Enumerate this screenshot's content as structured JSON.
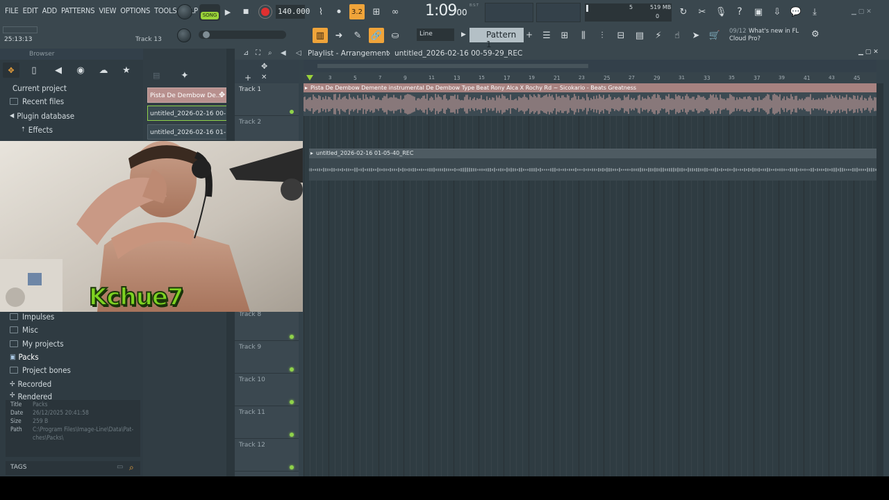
{
  "menu": [
    "FILE",
    "EDIT",
    "ADD",
    "PATTERNS",
    "VIEW",
    "OPTIONS",
    "TOOLS",
    "HELP"
  ],
  "transport": {
    "song_label": "SONG",
    "tempo": "140.000",
    "time": "1:09",
    "time_small": "00",
    "time_unit": "B:S:T",
    "cpu": "519 MB",
    "voices": "5",
    "voices2": "0",
    "pattern_name": "Pattern 1",
    "snap": "Line"
  },
  "hint": {
    "time": "25:13:13",
    "track": "Track 13"
  },
  "news": {
    "count": "09/12",
    "text1": "What's new in FL",
    "text2": "Cloud Pro?"
  },
  "browser": {
    "title": "Browser",
    "items_top": [
      "Current project",
      "Recent files",
      "Plugin database",
      "Effects"
    ],
    "items_bottom": [
      "Impulses",
      "Misc",
      "My projects",
      "Packs",
      "Project bones",
      "Recorded",
      "Rendered"
    ],
    "info": {
      "title_k": "Title",
      "title_v": "Packs",
      "date_k": "Date",
      "date_v": "26/12/2025 20:41:58",
      "size_k": "Size",
      "size_v": "259 B",
      "path_k": "Path",
      "path_v1": "C:\\Program Files\\Image-Line\\Data\\Pat-",
      "path_v2": "ches\\Packs\\"
    },
    "tags": "TAGS"
  },
  "patterns": [
    "Pista De Dembow De...",
    "untitled_2026-02-16 00-...",
    "untitled_2026-02-16 01-..."
  ],
  "playlist": {
    "title": "Playlist - Arrangement",
    "sep": "›",
    "project": "untitled_2026-02-16 00-59-29_REC",
    "clip1": "Pista De Dembow Demente instrumental De Dembow Type Beat Rony Alca X Rochy Rd ~ Sicokario - Beats Greatness",
    "clip2": "untitled_2026-02-16 01-05-40_REC"
  },
  "tracks": [
    "Track 1",
    "Track 2",
    "Track 8",
    "Track 9",
    "Track 10",
    "Track 11",
    "Track 12"
  ],
  "ruler": [
    "3",
    "5",
    "7",
    "9",
    "11",
    "13",
    "15",
    "17",
    "19",
    "21",
    "23",
    "25",
    "27",
    "29",
    "31",
    "33",
    "35",
    "37",
    "39",
    "41",
    "43",
    "45"
  ],
  "webcam": {
    "overlay": "Kchue7"
  },
  "colors": {
    "accent": "#f0a43a",
    "record": "#e03030",
    "clip1": "#d4a7a3",
    "led": "#8fd24a"
  }
}
